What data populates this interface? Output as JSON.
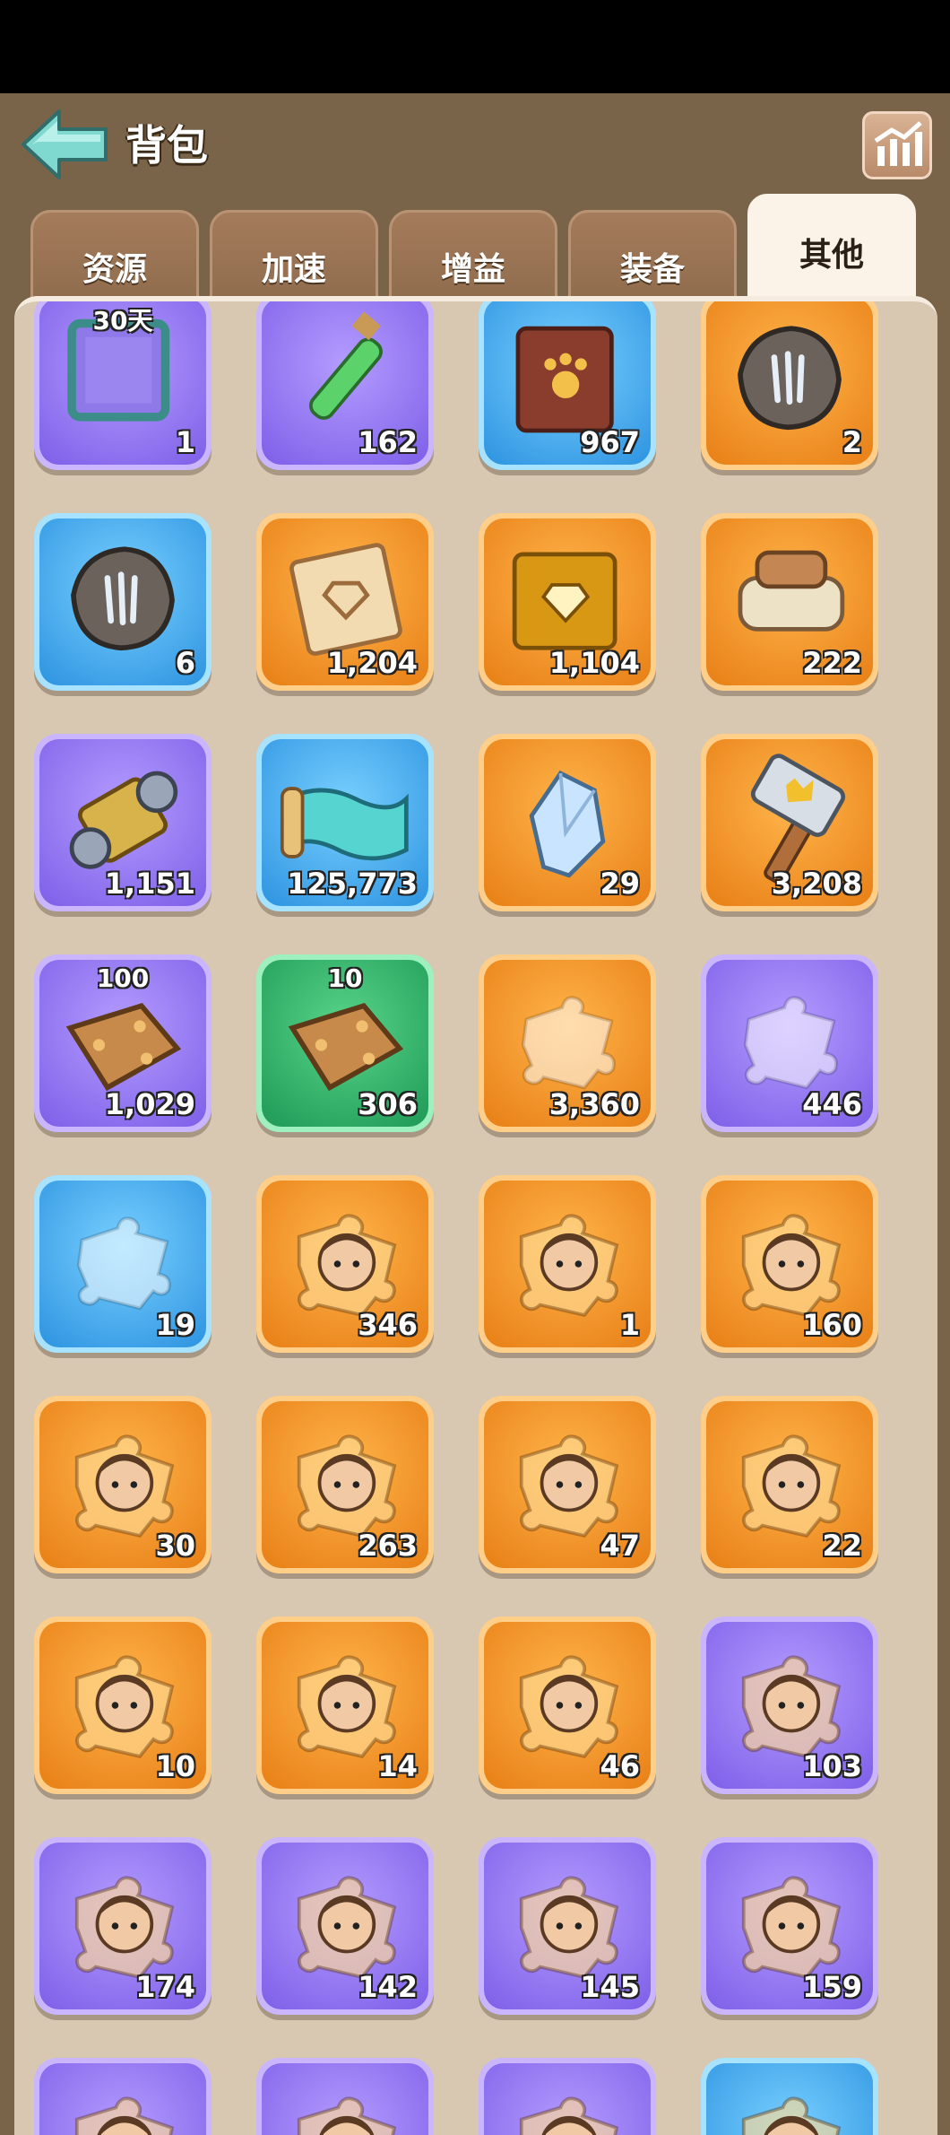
{
  "header": {
    "title": "背包"
  },
  "tabs": [
    {
      "label": "资源",
      "active": false
    },
    {
      "label": "加速",
      "active": false
    },
    {
      "label": "增益",
      "active": false
    },
    {
      "label": "装备",
      "active": false
    },
    {
      "label": "其他",
      "active": true
    }
  ],
  "items": [
    {
      "name": "avatar-frame",
      "quality": "purple",
      "count": "1",
      "top_label": "30天",
      "icon": "frame-icon"
    },
    {
      "name": "green-potion",
      "quality": "purple",
      "count": "162",
      "icon": "potion-icon"
    },
    {
      "name": "paw-book",
      "quality": "blue",
      "count": "967",
      "icon": "paw-book-icon"
    },
    {
      "name": "claw-stone-orange",
      "quality": "orange",
      "count": "2",
      "icon": "claw-stone-icon"
    },
    {
      "name": "claw-stone-blue",
      "quality": "blue",
      "count": "6",
      "icon": "claw-stone-icon"
    },
    {
      "name": "diamond-scroll",
      "quality": "orange",
      "count": "1,204",
      "icon": "scroll-icon"
    },
    {
      "name": "diamond-book",
      "quality": "orange",
      "count": "1,104",
      "icon": "gold-book-icon"
    },
    {
      "name": "blueprint-scroll",
      "quality": "orange",
      "count": "222",
      "icon": "blueprint-icon"
    },
    {
      "name": "thread-spool",
      "quality": "purple",
      "count": "1,151",
      "icon": "spool-icon"
    },
    {
      "name": "cloth-roll",
      "quality": "blue",
      "count": "125,773",
      "icon": "cloth-icon"
    },
    {
      "name": "crystal",
      "quality": "orange",
      "count": "29",
      "icon": "crystal-icon"
    },
    {
      "name": "crown-hammer",
      "quality": "orange",
      "count": "3,208",
      "icon": "hammer-icon"
    },
    {
      "name": "bronze-plate-100",
      "quality": "purple",
      "count": "1,029",
      "top_label": "100",
      "icon": "plate-icon"
    },
    {
      "name": "bronze-plate-10",
      "quality": "green",
      "count": "306",
      "top_label": "10",
      "icon": "plate-icon"
    },
    {
      "name": "puzzle-orange",
      "quality": "orange",
      "count": "3,360",
      "icon": "puzzle-icon"
    },
    {
      "name": "puzzle-purple",
      "quality": "purple",
      "count": "446",
      "icon": "puzzle-icon"
    },
    {
      "name": "puzzle-blue",
      "quality": "blue",
      "count": "19",
      "icon": "puzzle-icon"
    },
    {
      "name": "hero-shard-1",
      "quality": "orange",
      "count": "346",
      "icon": "hero-shard-icon"
    },
    {
      "name": "hero-shard-2",
      "quality": "orange",
      "count": "1",
      "icon": "hero-shard-icon"
    },
    {
      "name": "hero-shard-3",
      "quality": "orange",
      "count": "160",
      "icon": "hero-shard-icon"
    },
    {
      "name": "hero-shard-4",
      "quality": "orange",
      "count": "30",
      "icon": "hero-shard-icon"
    },
    {
      "name": "hero-shard-5",
      "quality": "orange",
      "count": "263",
      "icon": "hero-shard-icon"
    },
    {
      "name": "hero-shard-6",
      "quality": "orange",
      "count": "47",
      "icon": "hero-shard-icon"
    },
    {
      "name": "hero-shard-7",
      "quality": "orange",
      "count": "22",
      "icon": "hero-shard-icon"
    },
    {
      "name": "hero-shard-8",
      "quality": "orange",
      "count": "10",
      "icon": "hero-shard-icon"
    },
    {
      "name": "hero-shard-9",
      "quality": "orange",
      "count": "14",
      "icon": "hero-shard-icon"
    },
    {
      "name": "hero-shard-10",
      "quality": "orange",
      "count": "46",
      "icon": "hero-shard-icon"
    },
    {
      "name": "hero-shard-11",
      "quality": "purple",
      "count": "103",
      "icon": "hero-shard-icon"
    },
    {
      "name": "hero-shard-12",
      "quality": "purple",
      "count": "174",
      "icon": "hero-shard-icon"
    },
    {
      "name": "hero-shard-13",
      "quality": "purple",
      "count": "142",
      "icon": "hero-shard-icon"
    },
    {
      "name": "hero-shard-14",
      "quality": "purple",
      "count": "145",
      "icon": "hero-shard-icon"
    },
    {
      "name": "hero-shard-15",
      "quality": "purple",
      "count": "159",
      "icon": "hero-shard-icon"
    },
    {
      "name": "partial-item-1",
      "quality": "purple",
      "count": "",
      "icon": "hero-shard-icon"
    },
    {
      "name": "partial-item-2",
      "quality": "purple",
      "count": "",
      "icon": "hero-shard-icon"
    },
    {
      "name": "partial-item-3",
      "quality": "purple",
      "count": "",
      "icon": "hero-shard-icon"
    },
    {
      "name": "partial-item-4",
      "quality": "blue",
      "count": "",
      "icon": "hero-shard-icon"
    }
  ]
}
